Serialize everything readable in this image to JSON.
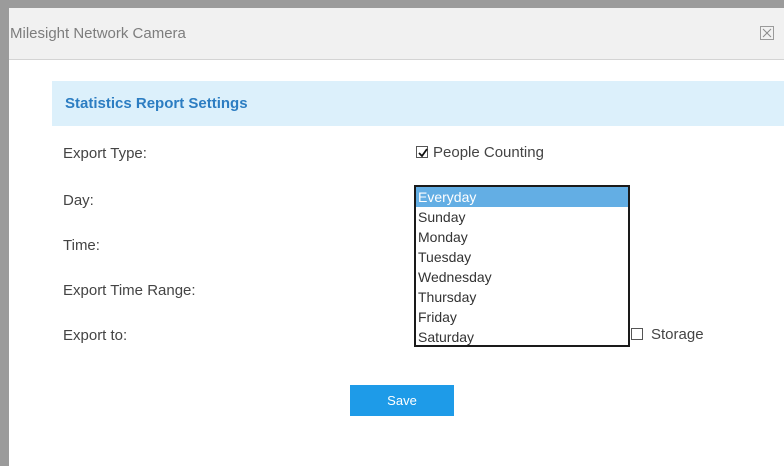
{
  "window": {
    "title": "Milesight Network Camera"
  },
  "section": {
    "title": "Statistics Report Settings"
  },
  "form": {
    "export_type_label": "Export Type:",
    "day_label": "Day:",
    "time_label": "Time:",
    "export_time_range_label": "Export Time Range:",
    "export_to_label": "Export to:",
    "people_counting": {
      "label": "People Counting",
      "checked": true
    },
    "storage": {
      "label": "Storage",
      "checked": false
    }
  },
  "day_dropdown": {
    "selected": "Everyday",
    "options": [
      "Everyday",
      "Sunday",
      "Monday",
      "Tuesday",
      "Wednesday",
      "Thursday",
      "Friday",
      "Saturday"
    ]
  },
  "save_label": "Save",
  "colors": {
    "section_bg": "#dcf0fb",
    "section_title": "#2c7dc2",
    "save_button": "#1e9be8",
    "selected_option": "#63aee4"
  }
}
